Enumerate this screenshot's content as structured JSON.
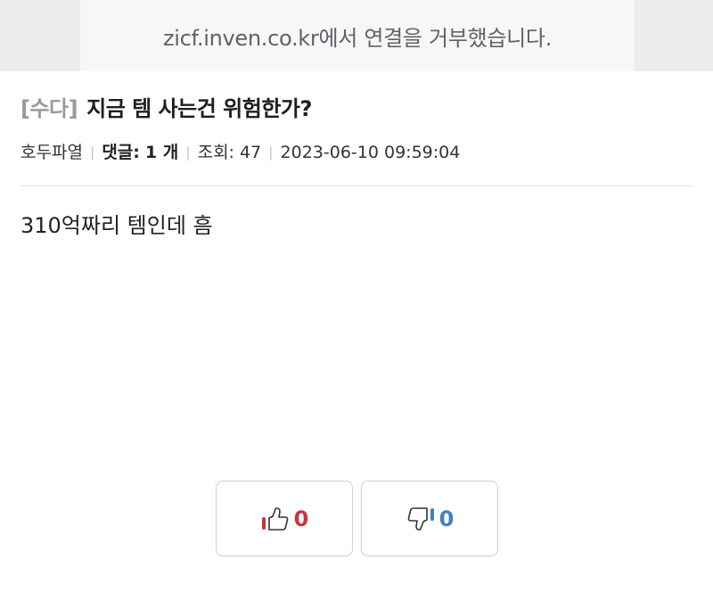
{
  "embed": {
    "error_message": "zicf.inven.co.kr에서 연결을 거부했습니다."
  },
  "post": {
    "category": "[수다]",
    "title": "지금 템 사는건 위험한가?",
    "author": "호두파열",
    "comments_label": "댓글:",
    "comments_count": "1 개",
    "views_label": "조회:",
    "views_count": "47",
    "datetime": "2023-06-10 09:59:04",
    "body": "310억짜리 템인데 흠"
  },
  "votes": {
    "up_count": "0",
    "down_count": "0",
    "up_icon": "thumbs-up-icon",
    "down_icon": "thumbs-down-icon",
    "up_color": "#c9353b",
    "down_color": "#3f7fbf"
  }
}
